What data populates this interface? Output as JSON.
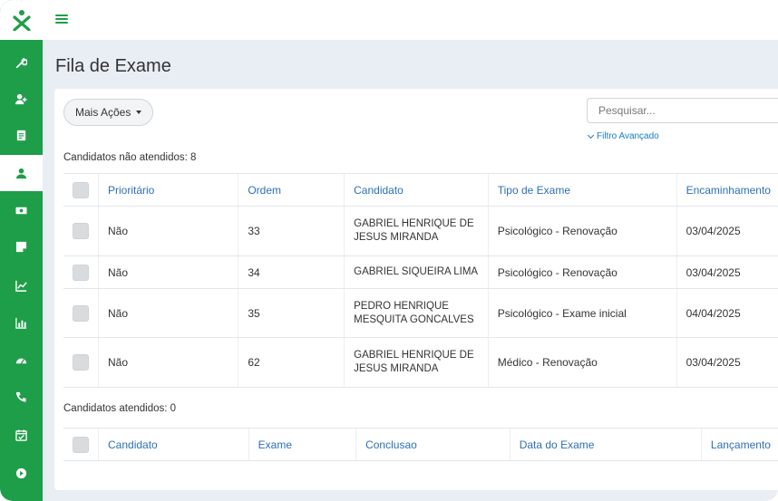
{
  "page": {
    "title": "Fila de Exame"
  },
  "sidebar": {
    "logo": "X",
    "items": [
      {
        "icon": "wrench-icon"
      },
      {
        "icon": "user-plus-icon"
      },
      {
        "icon": "document-icon"
      },
      {
        "icon": "user-icon",
        "active": true
      },
      {
        "icon": "money-icon"
      },
      {
        "icon": "note-icon"
      },
      {
        "icon": "line-chart-icon"
      },
      {
        "icon": "bar-chart-icon"
      },
      {
        "icon": "dashboard-icon"
      },
      {
        "icon": "phone-icon"
      },
      {
        "icon": "calendar-check-icon"
      },
      {
        "icon": "play-circle-icon"
      }
    ]
  },
  "toolbar": {
    "actions_label": "Mais Ações",
    "search_placeholder": "Pesquisar...",
    "advanced_filter_label": "Filtro Avançado"
  },
  "pending": {
    "label": "Candidatos não atendidos: 8",
    "columns": [
      "Prioritário",
      "Ordem",
      "Candidato",
      "Tipo de Exame",
      "Encaminhamento"
    ],
    "rows": [
      {
        "prioritario": "Não",
        "ordem": "33",
        "candidato_l1": "GABRIEL HENRIQUE DE",
        "candidato_l2": "JESUS MIRANDA",
        "tipo": "Psicológico - Renovação",
        "encaminhamento": "03/04/2025"
      },
      {
        "prioritario": "Não",
        "ordem": "34",
        "candidato_l1": "GABRIEL SIQUEIRA LIMA",
        "candidato_l2": "",
        "tipo": "Psicológico - Renovação",
        "encaminhamento": "03/04/2025"
      },
      {
        "prioritario": "Não",
        "ordem": "35",
        "candidato_l1": "PEDRO HENRIQUE",
        "candidato_l2": "MESQUITA GONCALVES",
        "tipo": "Psicológico - Exame inicial",
        "encaminhamento": "04/04/2025"
      },
      {
        "prioritario": "Não",
        "ordem": "62",
        "candidato_l1": "GABRIEL HENRIQUE DE",
        "candidato_l2": "JESUS MIRANDA",
        "tipo": "Médico - Renovação",
        "encaminhamento": "03/04/2025"
      }
    ]
  },
  "attended": {
    "label": "Candidatos atendidos: 0",
    "columns": [
      "Candidato",
      "Exame",
      "Conclusao",
      "Data do Exame",
      "Lançamento"
    ]
  },
  "colors": {
    "brand": "#1e9e48",
    "link": "#2d6fb8",
    "background": "#e9eef5"
  }
}
